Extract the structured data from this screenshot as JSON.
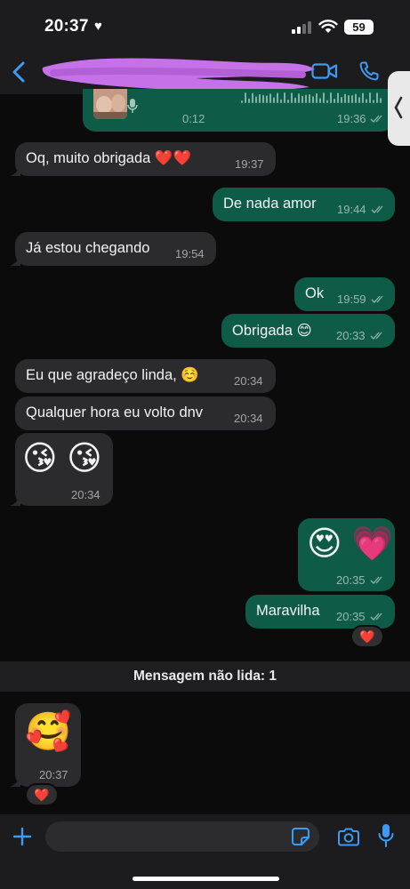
{
  "status_bar": {
    "time": "20:37",
    "battery": "59"
  },
  "header": {
    "back_icon": "chevron-left-icon",
    "video_icon": "video-camera-icon",
    "phone_icon": "phone-icon"
  },
  "colors": {
    "incoming_bubble": "#2b2b2d",
    "outgoing_bubble": "#0e5c48",
    "accent_blue": "#3d9bf3",
    "background": "#0b0b0b"
  },
  "voice_message": {
    "duration": "0:12",
    "time": "19:36"
  },
  "messages": [
    {
      "text": "Oq, muito obrigada ❤️❤️",
      "time": "19:37"
    },
    {
      "text": "De nada amor",
      "time": "19:44"
    },
    {
      "text": "Já estou chegando",
      "time": "19:54"
    },
    {
      "text": "Ok",
      "time": "19:59"
    },
    {
      "text": "Obrigada 😊",
      "time": "20:33"
    },
    {
      "text": "Eu que agradeço linda, ☺️",
      "time": "20:34"
    },
    {
      "text": "Qualquer hora eu volto dnv",
      "time": "20:34"
    },
    {
      "text": "😘 😘",
      "time": "20:34"
    },
    {
      "text": "😍 💗",
      "time": "20:35"
    },
    {
      "text": "Maravilha",
      "time": "20:35",
      "reaction": "❤️"
    },
    {
      "text": "🥰",
      "time": "20:37",
      "reaction": "❤️"
    }
  ],
  "unread_banner": "Mensagem não lida: 1",
  "input_bar": {
    "placeholder": ""
  }
}
